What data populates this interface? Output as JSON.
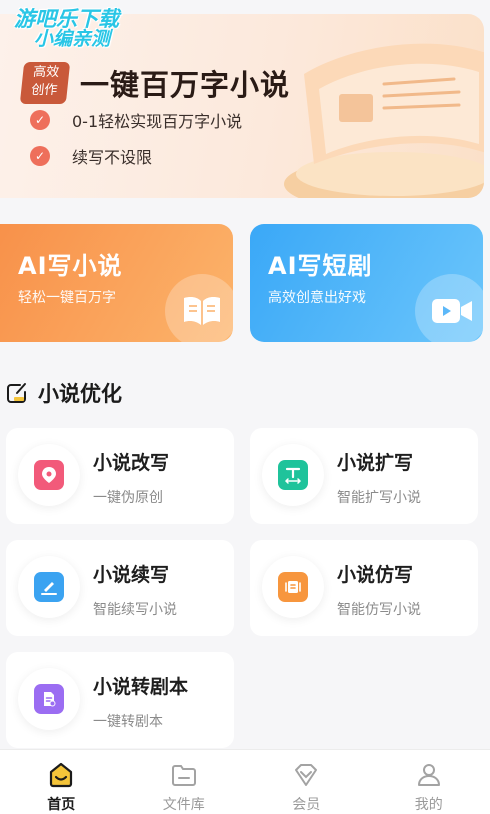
{
  "watermark": {
    "line1": "游吧乐下载",
    "line2": "小编亲测"
  },
  "banner": {
    "badge": [
      "高效",
      "创作"
    ],
    "title": "一键百万字小说",
    "features": [
      "0-1轻松实现百万字小说",
      "续写不设限"
    ]
  },
  "cards": [
    {
      "title": "AI写小说",
      "subtitle": "轻松一键百万字",
      "icon": "book-icon",
      "color": "#f8914a"
    },
    {
      "title": "AI写短剧",
      "subtitle": "高效创意出好戏",
      "icon": "video-camera-icon",
      "color": "#3aa8f7"
    }
  ],
  "section": {
    "title": "小说优化"
  },
  "tools": [
    {
      "title": "小说改写",
      "subtitle": "一键伪原创",
      "icon": "rewrite-icon",
      "color": "#f25a7a"
    },
    {
      "title": "小说扩写",
      "subtitle": "智能扩写小说",
      "icon": "expand-text-icon",
      "color": "#1fc39b"
    },
    {
      "title": "小说续写",
      "subtitle": "智能续写小说",
      "icon": "continue-pen-icon",
      "color": "#3ba3f1"
    },
    {
      "title": "小说仿写",
      "subtitle": "智能仿写小说",
      "icon": "imitate-scroll-icon",
      "color": "#f7963e"
    },
    {
      "title": "小说转剧本",
      "subtitle": "一键转剧本",
      "icon": "script-doc-icon",
      "color": "#9b6df2"
    }
  ],
  "tabbar": [
    {
      "label": "首页",
      "icon": "home-icon",
      "active": true
    },
    {
      "label": "文件库",
      "icon": "folder-icon",
      "active": false
    },
    {
      "label": "会员",
      "icon": "vip-diamond-icon",
      "active": false
    },
    {
      "label": "我的",
      "icon": "profile-icon",
      "active": false
    }
  ],
  "colors": {
    "accent": "#f4c43a",
    "banner_check": "#ee6f5b"
  }
}
